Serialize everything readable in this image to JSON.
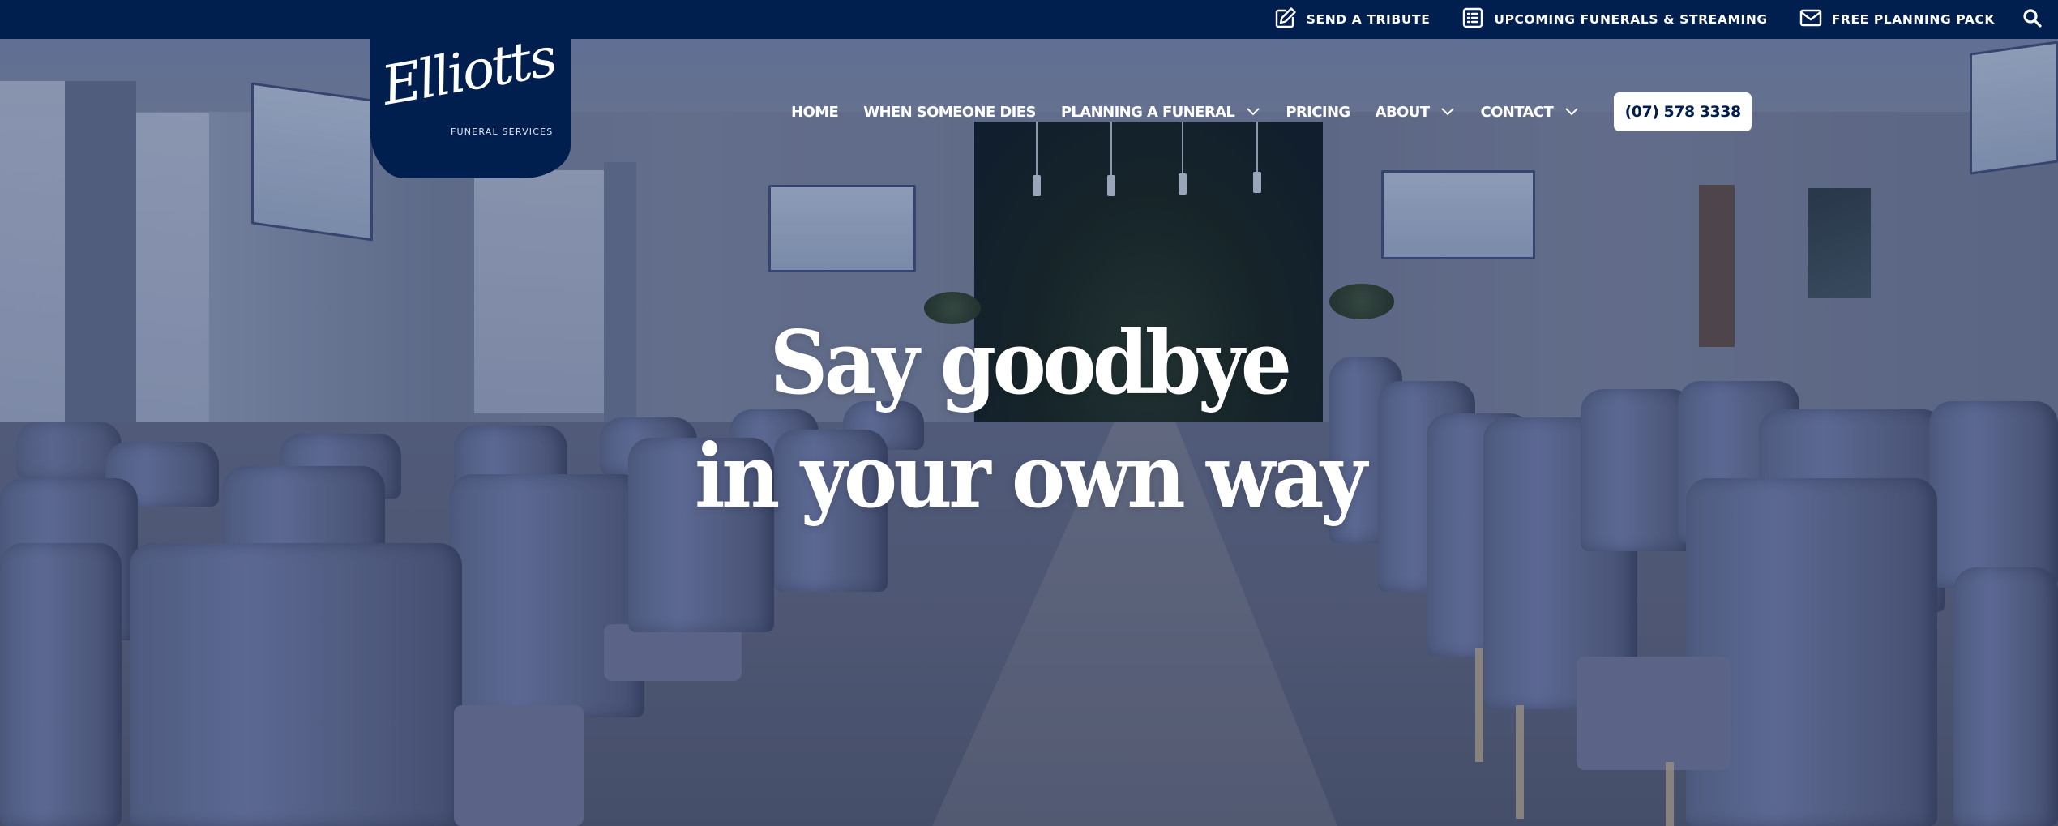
{
  "brand": {
    "name_script": "Elliotts",
    "tagline": "FUNERAL SERVICES",
    "color_primary": "#001f4f",
    "color_text_light": "#ffffff"
  },
  "utility_bar": {
    "links": [
      {
        "label": "SEND A TRIBUTE",
        "icon": "edit-pencil-icon"
      },
      {
        "label": "UPCOMING FUNERALS & STREAMING",
        "icon": "list-document-icon"
      },
      {
        "label": "FREE PLANNING PACK",
        "icon": "envelope-icon"
      }
    ],
    "search_icon": "search-icon"
  },
  "nav": {
    "items": [
      {
        "label": "HOME",
        "has_dropdown": false
      },
      {
        "label": "WHEN SOMEONE DIES",
        "has_dropdown": false
      },
      {
        "label": "PLANNING A FUNERAL",
        "has_dropdown": true
      },
      {
        "label": "PRICING",
        "has_dropdown": false
      },
      {
        "label": "ABOUT",
        "has_dropdown": true
      },
      {
        "label": "CONTACT",
        "has_dropdown": true
      }
    ],
    "phone_button": "(07) 578 3338"
  },
  "hero": {
    "headline_line1": "Say goodbye",
    "headline_line2": "in your own way",
    "background_description": "chapel interior with rows of upholstered chairs and green wall"
  }
}
